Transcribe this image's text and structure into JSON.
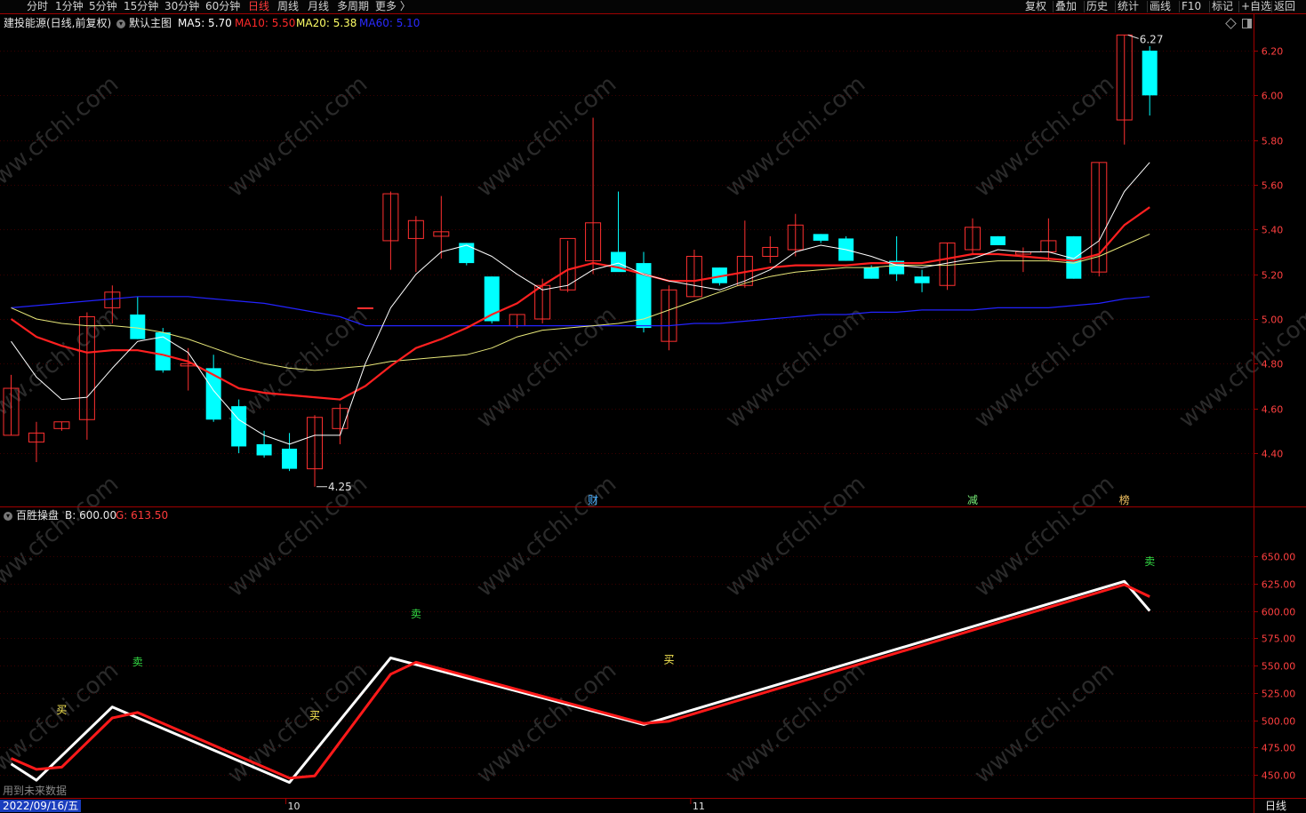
{
  "toolbar": {
    "periods": [
      {
        "label": "分时",
        "active": false
      },
      {
        "label": "1分钟",
        "active": false
      },
      {
        "label": "5分钟",
        "active": false
      },
      {
        "label": "15分钟",
        "active": false
      },
      {
        "label": "30分钟",
        "active": false
      },
      {
        "label": "60分钟",
        "active": false
      },
      {
        "label": "日线",
        "active": true
      },
      {
        "label": "周线",
        "active": false
      },
      {
        "label": "月线",
        "active": false
      },
      {
        "label": "多周期",
        "active": false
      },
      {
        "label": "更多 〉",
        "active": false
      }
    ],
    "right_buttons": [
      "复权",
      "叠加",
      "历史",
      "统计",
      "画线",
      "F10",
      "标记",
      "+自选",
      "返回"
    ]
  },
  "main_chart": {
    "stock_title": "建投能源(日线,前复权)",
    "template_label": "默认主图",
    "ma": [
      {
        "label": "MA5: 5.70",
        "color": "#ffffff"
      },
      {
        "label": "MA10: 5.50",
        "color": "#ff2a2a"
      },
      {
        "label": "MA20: 5.38",
        "color": "#ffff66"
      },
      {
        "label": "MA60: 5.10",
        "color": "#2a2aff"
      }
    ],
    "y_ticks": [
      "6.20",
      "6.00",
      "5.80",
      "5.60",
      "5.40",
      "5.20",
      "5.00",
      "4.80",
      "4.60",
      "4.40"
    ],
    "high_marker": "6.27",
    "low_marker": "4.25",
    "event_markers": [
      {
        "label": "财",
        "color": "#4ab0ff"
      },
      {
        "label": "减",
        "color": "#77ee77"
      },
      {
        "label": "榜",
        "color": "#f0c060"
      }
    ]
  },
  "chart_data": {
    "type": "candlestick",
    "ylim": [
      4.2,
      6.3
    ],
    "candles": [
      {
        "o": 4.48,
        "h": 4.75,
        "l": 4.48,
        "c": 4.69
      },
      {
        "o": 4.45,
        "h": 4.54,
        "l": 4.36,
        "c": 4.49
      },
      {
        "o": 4.51,
        "h": 4.54,
        "l": 4.5,
        "c": 4.54
      },
      {
        "o": 4.55,
        "h": 5.03,
        "l": 4.46,
        "c": 5.01
      },
      {
        "o": 5.05,
        "h": 5.15,
        "l": 4.98,
        "c": 5.12
      },
      {
        "o": 5.02,
        "h": 5.1,
        "l": 4.91,
        "c": 4.91
      },
      {
        "o": 4.94,
        "h": 4.96,
        "l": 4.76,
        "c": 4.77
      },
      {
        "o": 4.79,
        "h": 4.87,
        "l": 4.68,
        "c": 4.8
      },
      {
        "o": 4.78,
        "h": 4.84,
        "l": 4.54,
        "c": 4.55
      },
      {
        "o": 4.61,
        "h": 4.64,
        "l": 4.4,
        "c": 4.43
      },
      {
        "o": 4.44,
        "h": 4.5,
        "l": 4.38,
        "c": 4.39
      },
      {
        "o": 4.42,
        "h": 4.49,
        "l": 4.32,
        "c": 4.33
      },
      {
        "o": 4.33,
        "h": 4.57,
        "l": 4.25,
        "c": 4.56
      },
      {
        "o": 4.51,
        "h": 4.62,
        "l": 4.44,
        "c": 4.6
      },
      {
        "o": 5.05,
        "h": 5.05,
        "l": 5.05,
        "c": 5.05
      },
      {
        "o": 5.35,
        "h": 5.57,
        "l": 5.22,
        "c": 5.56
      },
      {
        "o": 5.36,
        "h": 5.46,
        "l": 5.21,
        "c": 5.44
      },
      {
        "o": 5.37,
        "h": 5.55,
        "l": 5.27,
        "c": 5.39
      },
      {
        "o": 5.34,
        "h": 5.34,
        "l": 5.24,
        "c": 5.25
      },
      {
        "o": 5.19,
        "h": 5.19,
        "l": 4.98,
        "c": 4.99
      },
      {
        "o": 4.97,
        "h": 5.02,
        "l": 4.96,
        "c": 5.02
      },
      {
        "o": 5.0,
        "h": 5.18,
        "l": 4.98,
        "c": 5.15
      },
      {
        "o": 5.13,
        "h": 5.35,
        "l": 5.12,
        "c": 5.36
      },
      {
        "o": 5.26,
        "h": 5.9,
        "l": 5.2,
        "c": 5.43
      },
      {
        "o": 5.3,
        "h": 5.57,
        "l": 5.28,
        "c": 5.21
      },
      {
        "o": 5.25,
        "h": 5.3,
        "l": 4.94,
        "c": 4.96
      },
      {
        "o": 4.9,
        "h": 5.15,
        "l": 4.86,
        "c": 5.13
      },
      {
        "o": 5.1,
        "h": 5.31,
        "l": 5.1,
        "c": 5.28
      },
      {
        "o": 5.23,
        "h": 5.23,
        "l": 5.15,
        "c": 5.16
      },
      {
        "o": 5.15,
        "h": 5.44,
        "l": 5.14,
        "c": 5.28
      },
      {
        "o": 5.28,
        "h": 5.37,
        "l": 5.25,
        "c": 5.32
      },
      {
        "o": 5.31,
        "h": 5.47,
        "l": 5.28,
        "c": 5.42
      },
      {
        "o": 5.38,
        "h": 5.38,
        "l": 5.34,
        "c": 5.35
      },
      {
        "o": 5.36,
        "h": 5.37,
        "l": 5.26,
        "c": 5.26
      },
      {
        "o": 5.23,
        "h": 5.24,
        "l": 5.18,
        "c": 5.18
      },
      {
        "o": 5.26,
        "h": 5.37,
        "l": 5.17,
        "c": 5.2
      },
      {
        "o": 5.19,
        "h": 5.22,
        "l": 5.12,
        "c": 5.16
      },
      {
        "o": 5.15,
        "h": 5.34,
        "l": 5.13,
        "c": 5.34
      },
      {
        "o": 5.31,
        "h": 5.45,
        "l": 5.29,
        "c": 5.41
      },
      {
        "o": 5.37,
        "h": 5.37,
        "l": 5.33,
        "c": 5.33
      },
      {
        "o": 5.29,
        "h": 5.32,
        "l": 5.21,
        "c": 5.3
      },
      {
        "o": 5.3,
        "h": 5.45,
        "l": 5.26,
        "c": 5.35
      },
      {
        "o": 5.37,
        "h": 5.37,
        "l": 5.18,
        "c": 5.18
      },
      {
        "o": 5.21,
        "h": 5.7,
        "l": 5.19,
        "c": 5.7
      },
      {
        "o": 5.89,
        "h": 6.27,
        "l": 5.78,
        "c": 6.27
      },
      {
        "o": 6.2,
        "h": 6.22,
        "l": 5.91,
        "c": 6.0
      }
    ],
    "ma5": [
      4.9,
      4.74,
      4.64,
      4.65,
      4.78,
      4.9,
      4.92,
      4.85,
      4.68,
      4.55,
      4.48,
      4.44,
      4.48,
      4.48,
      4.8,
      5.05,
      5.2,
      5.3,
      5.33,
      5.28,
      5.2,
      5.13,
      5.15,
      5.22,
      5.25,
      5.2,
      5.17,
      5.15,
      5.13,
      5.17,
      5.22,
      5.3,
      5.33,
      5.31,
      5.28,
      5.24,
      5.23,
      5.25,
      5.27,
      5.31,
      5.3,
      5.3,
      5.27,
      5.35,
      5.57,
      5.7
    ],
    "ma10": [
      5.0,
      4.92,
      4.88,
      4.85,
      4.86,
      4.86,
      4.84,
      4.81,
      4.75,
      4.69,
      4.67,
      4.66,
      4.65,
      4.64,
      4.7,
      4.79,
      4.87,
      4.91,
      4.96,
      5.02,
      5.07,
      5.15,
      5.22,
      5.25,
      5.23,
      5.2,
      5.17,
      5.17,
      5.19,
      5.21,
      5.23,
      5.24,
      5.24,
      5.24,
      5.25,
      5.25,
      5.25,
      5.27,
      5.29,
      5.29,
      5.28,
      5.27,
      5.26,
      5.29,
      5.42,
      5.5
    ],
    "ma20": [
      5.05,
      5.0,
      4.98,
      4.97,
      4.97,
      4.96,
      4.94,
      4.91,
      4.87,
      4.83,
      4.8,
      4.78,
      4.77,
      4.78,
      4.79,
      4.81,
      4.82,
      4.83,
      4.84,
      4.87,
      4.92,
      4.95,
      4.96,
      4.97,
      4.98,
      5.0,
      5.04,
      5.08,
      5.12,
      5.16,
      5.19,
      5.21,
      5.22,
      5.23,
      5.23,
      5.24,
      5.24,
      5.24,
      5.25,
      5.26,
      5.26,
      5.26,
      5.25,
      5.28,
      5.33,
      5.38
    ],
    "ma60": [
      5.05,
      5.06,
      5.07,
      5.08,
      5.09,
      5.1,
      5.1,
      5.1,
      5.09,
      5.08,
      5.07,
      5.05,
      5.03,
      5.01,
      4.97,
      4.97,
      4.97,
      4.97,
      4.97,
      4.97,
      4.97,
      4.97,
      4.97,
      4.97,
      4.97,
      4.97,
      4.97,
      4.98,
      4.98,
      4.99,
      5.0,
      5.01,
      5.02,
      5.02,
      5.03,
      5.03,
      5.04,
      5.04,
      5.04,
      5.05,
      5.05,
      5.05,
      5.06,
      5.07,
      5.09,
      5.1
    ]
  },
  "sub_chart": {
    "name": "百胜操盘",
    "b_label": "B: 600.00",
    "g_label": "G: 613.50",
    "y_ticks": [
      "650.00",
      "625.00",
      "600.00",
      "575.00",
      "550.00",
      "525.00",
      "500.00",
      "475.00",
      "450.00"
    ],
    "ylim": [
      440,
      680
    ],
    "white_line": [
      [
        0,
        460
      ],
      [
        1,
        445
      ],
      [
        4,
        512
      ],
      [
        11,
        443
      ],
      [
        15,
        557
      ],
      [
        25,
        496
      ],
      [
        44,
        627
      ],
      [
        45,
        600
      ]
    ],
    "red_line": [
      [
        0,
        465
      ],
      [
        1,
        455
      ],
      [
        2,
        457
      ],
      [
        4,
        502
      ],
      [
        5,
        507
      ],
      [
        11,
        447
      ],
      [
        12,
        449
      ],
      [
        15,
        542
      ],
      [
        16,
        553
      ],
      [
        25,
        497
      ],
      [
        26,
        499
      ],
      [
        44,
        624
      ],
      [
        45,
        613
      ]
    ],
    "signals": [
      {
        "label": "买",
        "color": "#ffee55",
        "idx": 2,
        "value": 506
      },
      {
        "label": "卖",
        "color": "#33dd44",
        "idx": 5,
        "value": 550
      },
      {
        "label": "买",
        "color": "#ffee55",
        "idx": 12,
        "value": 501
      },
      {
        "label": "卖",
        "color": "#33dd44",
        "idx": 16,
        "value": 594
      },
      {
        "label": "买",
        "color": "#ffee55",
        "idx": 26,
        "value": 552
      },
      {
        "label": "卖",
        "color": "#33dd44",
        "idx": 45,
        "value": 642
      }
    ],
    "warning": "用到未来数据"
  },
  "x_axis": {
    "date_label": "2022/09/16/五",
    "tick_labels": [
      {
        "label": "10",
        "idx": 11
      },
      {
        "label": "11",
        "idx": 27
      }
    ],
    "period_label": "日线"
  },
  "watermark": "www.cfchi.com",
  "colors": {
    "up": "#ff3030",
    "down": "#00ffff",
    "grid": "#3a0000",
    "axis": "#a00000"
  }
}
